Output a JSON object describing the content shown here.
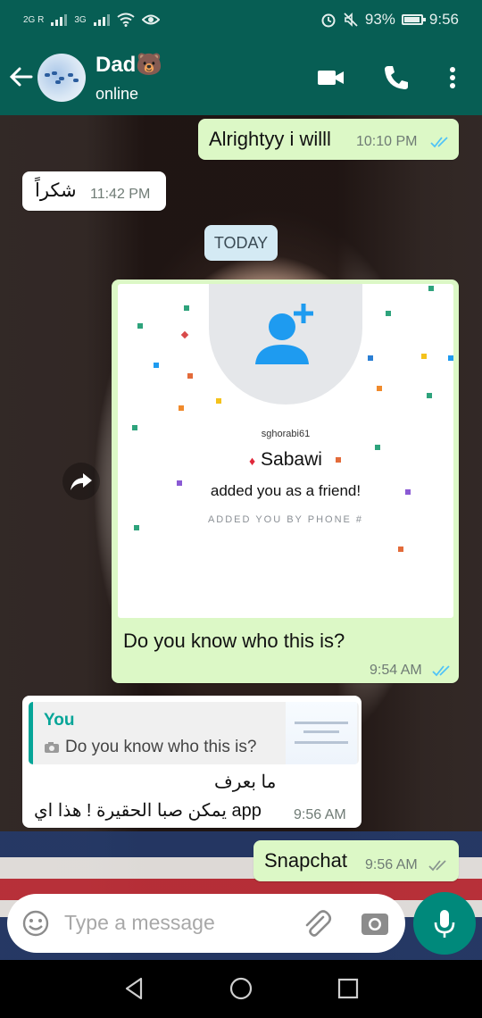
{
  "status_bar": {
    "network_1": "2G R",
    "network_2": "3G",
    "battery": "93%",
    "time": "9:56",
    "icons": [
      "signal-icon",
      "signal-icon",
      "wifi-icon",
      "eye-icon",
      "alarm-icon",
      "mute-icon",
      "battery-icon"
    ],
    "battery_level": 0.93
  },
  "header": {
    "contact_name": "Dad🐻",
    "contact_status": "online",
    "icons": [
      "back-arrow-icon",
      "video-call-icon",
      "phone-call-icon",
      "more-vert-icon"
    ]
  },
  "messages": [
    {
      "text": "Alrightyy i willl",
      "time": "10:10 PM",
      "direction": "out",
      "read": true
    },
    {
      "text": "شكراً",
      "time": "11:42 PM",
      "direction": "in"
    },
    {
      "date_chip": "TODAY"
    },
    {
      "direction": "out",
      "image": {
        "username": "sghorabi61",
        "name": "Sabawi",
        "added_text": "added you as a friend!",
        "added_by": "ADDED YOU BY PHONE #"
      },
      "caption": "Do you know who this is?",
      "time": "9:54 AM",
      "read": true
    },
    {
      "direction": "in",
      "quote": {
        "author": "You",
        "text": "Do you know who this is?"
      },
      "text_line1": "ما بعرف",
      "text_line2": "يمكن صبا الحقيرة ! هذا اي app",
      "time": "9:56 AM"
    },
    {
      "text": "Snapchat",
      "time": "9:56 AM",
      "direction": "out",
      "read": false
    }
  ],
  "composer": {
    "placeholder": "Type a message",
    "icons": [
      "emoji-icon",
      "attach-icon",
      "camera-icon",
      "mic-icon"
    ]
  },
  "colors": {
    "header": "#075e54",
    "outgoing_bubble": "#dcf8c6",
    "incoming_bubble": "#ffffff",
    "accent": "#00897b",
    "read_ticks": "#4fc3f7"
  }
}
